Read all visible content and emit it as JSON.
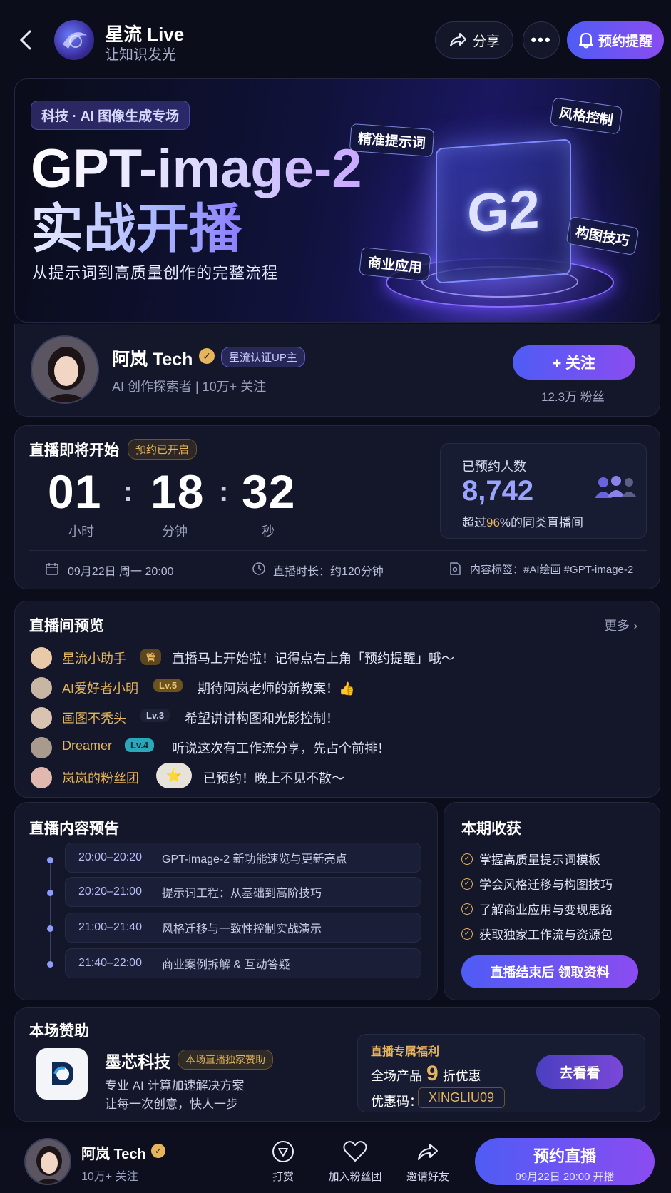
{
  "header": {
    "brand_name": "星流 Live",
    "brand_slogan": "让知识发光",
    "share_label": "分享",
    "remind_label": "预约提醒"
  },
  "hero": {
    "tag": "科技 · AI 图像生成专场",
    "title_line1": "GPT-image-2",
    "title_line2": "实战开播",
    "subtitle": "从提示词到高质量创作的完整流程",
    "cube_text": "G2",
    "floating_labels": [
      "精准提示词",
      "风格控制",
      "构图技巧",
      "商业应用"
    ]
  },
  "host": {
    "name": "阿岚 Tech",
    "badge": "星流认证UP主",
    "desc": "AI 创作探索者 | 10万+ 关注",
    "follow_label": "+ 关注",
    "fans": "12.3万 粉丝"
  },
  "countdown": {
    "title": "直播即将开始",
    "status": "预约已开启",
    "hours": "01",
    "minutes": "18",
    "seconds": "32",
    "hours_label": "小时",
    "minutes_label": "分钟",
    "seconds_label": "秒",
    "reserved_title": "已预约人数",
    "reserved_count": "8,742",
    "reserved_note_pre": "超过",
    "reserved_note_pct": "96",
    "reserved_note_post": "%的同类直播间",
    "date": "09月22日 周一 20:00",
    "duration": "直播时长：约120分钟",
    "tags": "内容标签：#AI绘画 #GPT-image-2"
  },
  "preview": {
    "title": "直播间预览",
    "more": "更多",
    "messages": [
      {
        "user": "星流小助手",
        "badge": "管",
        "text": "直播马上开始啦！记得点右上角「预约提醒」哦～"
      },
      {
        "user": "AI爱好者小明",
        "badge": "Lv.5",
        "text": "期待阿岚老师的新教案！👍"
      },
      {
        "user": "画图不秃头",
        "badge": "Lv.3",
        "text": "希望讲讲构图和光影控制！"
      },
      {
        "user": "Dreamer",
        "badge": "Lv.4",
        "text": "听说这次有工作流分享，先占个前排！"
      },
      {
        "user": "岚岚的粉丝团",
        "badge": "⭐",
        "text": "已预约！晚上不见不散～"
      }
    ]
  },
  "agenda": {
    "title": "直播内容预告",
    "items": [
      {
        "time": "20:00–20:20",
        "topic": "GPT-image-2 新功能速览与更新亮点"
      },
      {
        "time": "20:20–21:00",
        "topic": "提示词工程：从基础到高阶技巧"
      },
      {
        "time": "21:00–21:40",
        "topic": "风格迁移与一致性控制实战演示"
      },
      {
        "time": "21:40–22:00",
        "topic": "商业案例拆解 & 互动答疑"
      }
    ]
  },
  "gains": {
    "title": "本期收获",
    "items": [
      "掌握高质量提示词模板",
      "学会风格迁移与构图技巧",
      "了解商业应用与变现思路",
      "获取独家工作流与资源包"
    ],
    "button": "直播结束后 领取资料"
  },
  "sponsor": {
    "title": "本场赞助",
    "name": "墨芯科技",
    "badge": "本场直播独家赞助",
    "line1": "专业 AI 计算加速解决方案",
    "line2": "让每一次创意，快人一步",
    "perk_title": "直播专属福利",
    "perk_pre": "全场产品",
    "perk_num": "9",
    "perk_post": "折优惠",
    "coupon_label": "优惠码：",
    "coupon_code": "XINGLIU09",
    "go_label": "去看看"
  },
  "bottom": {
    "name": "阿岚 Tech",
    "followers": "10万+ 关注",
    "tip": "打赏",
    "fanclub": "加入粉丝团",
    "invite": "邀请好友",
    "cta_title": "预约直播",
    "cta_sub": "09月22日 20:00 开播"
  },
  "colors": {
    "accent": "#5b5cf5",
    "gold": "#e5b45c",
    "bg": "#0b0d1b"
  }
}
